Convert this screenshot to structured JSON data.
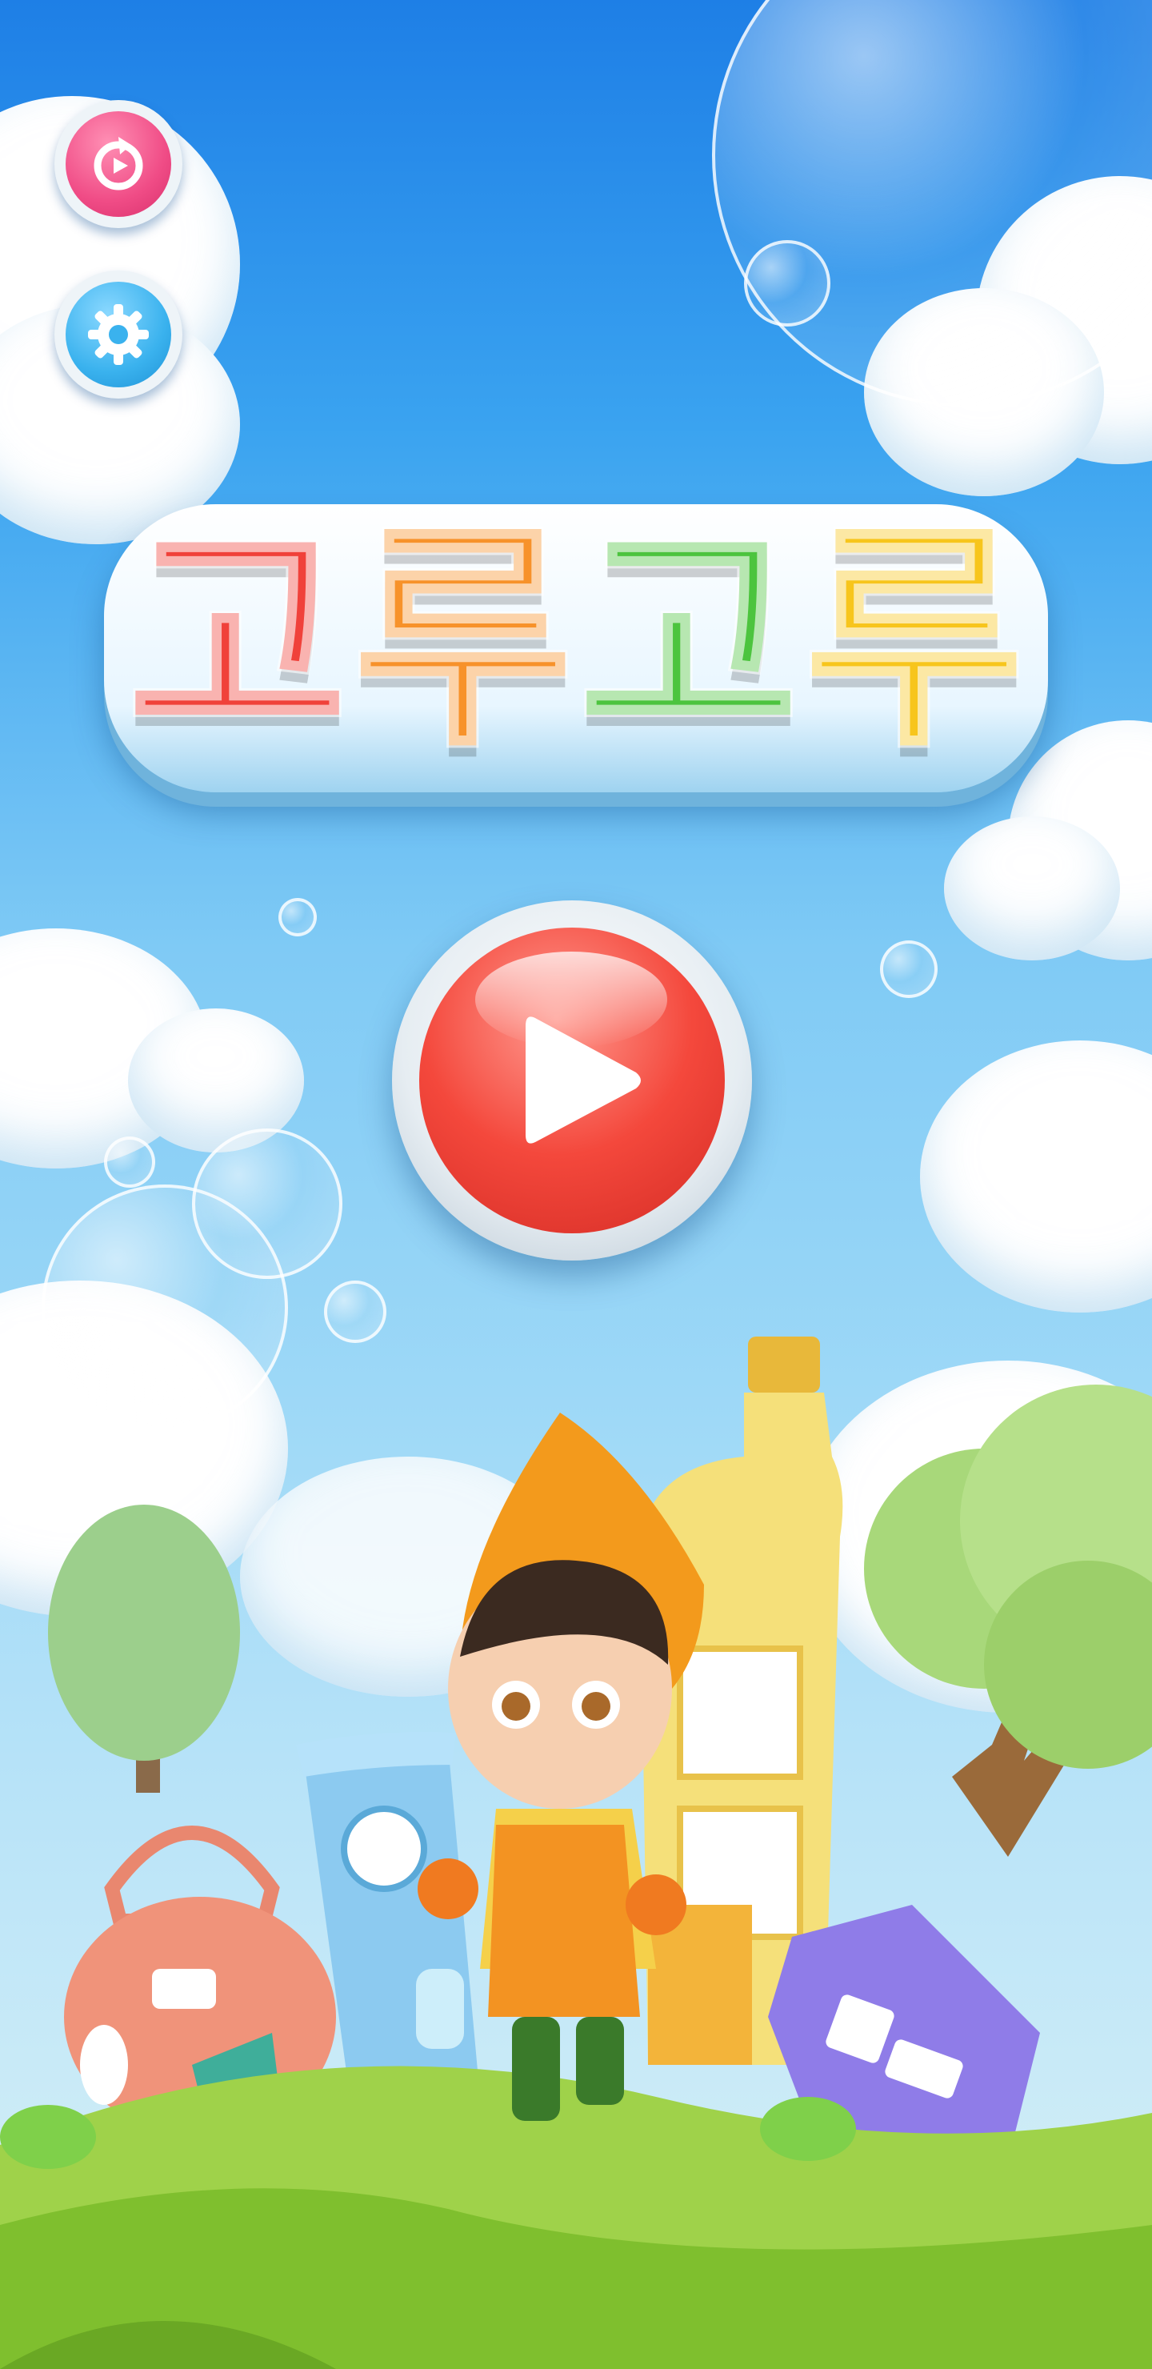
{
  "game": {
    "title_chars": [
      "고",
      "루",
      "고",
      "루"
    ],
    "title_colors": [
      "#f0413a",
      "#f7922a",
      "#4cc43e",
      "#f7c51c"
    ]
  },
  "buttons": {
    "restart": {
      "icon": "restart-icon",
      "color": "#f04c86"
    },
    "settings": {
      "icon": "gear-icon",
      "color": "#3ab2ee"
    },
    "play": {
      "icon": "play-icon",
      "color": "#f0453a"
    }
  },
  "scene": {
    "character": "boy-in-orange-hood",
    "buildings": [
      "kettle-house",
      "cup-house",
      "bottle-tower",
      "toaster-house"
    ],
    "trees": [
      "green-tree-left",
      "green-tree-right"
    ]
  }
}
